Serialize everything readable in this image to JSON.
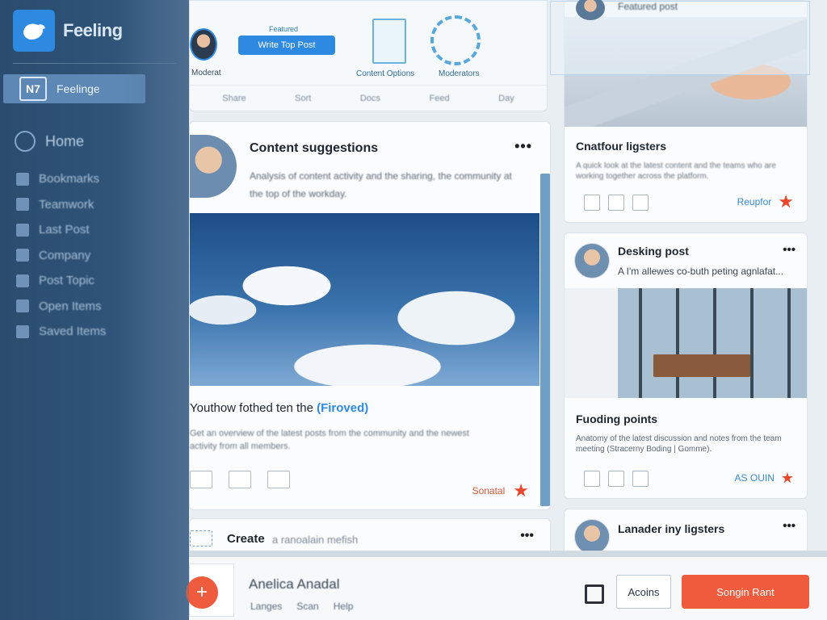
{
  "sidebar": {
    "brand": "Feeling",
    "active_item": {
      "label": "Feelinge",
      "icon_text": "N7"
    },
    "home_label": "Home",
    "items": [
      {
        "label": "Bookmarks"
      },
      {
        "label": "Teamwork"
      },
      {
        "label": "Last Post"
      },
      {
        "label": "Company"
      },
      {
        "label": "Post Topic"
      },
      {
        "label": "Open Items"
      },
      {
        "label": "Saved Items"
      }
    ]
  },
  "top_strip": {
    "user_label": "Moderat",
    "tag": "Featured",
    "button_label": "Write Top Post",
    "doc_label": "Content Options",
    "gear_label": "Moderators",
    "tabs": [
      "Share",
      "Sort",
      "Docs",
      "Feed",
      "Day"
    ]
  },
  "main_card": {
    "title": "Content suggestions",
    "more": "•••",
    "text": "Analysis of content activity and the sharing, the community at the top of the workday.",
    "headline_prefix": "Youthow fothed ten the ",
    "headline_highlight": "(Firoved)",
    "body": "Get an overview of the latest posts from the community and the newest activity from all members.",
    "action_label": "Sonatal"
  },
  "create": {
    "label": "Create",
    "sublabel": "a ranoalain mefish",
    "more": "•••"
  },
  "right_col": {
    "card1": {
      "top_title": "Featured post",
      "title": "Cnatfour ligsters",
      "text": "A quick look at the latest content and the teams who are working together across the platform.",
      "action_label": "Reupfor"
    },
    "card2": {
      "title": "Desking post",
      "subtitle": "A I'm allewes co-buth peting agnlafat...",
      "more": "•••",
      "title2": "Fuoding points",
      "text": "Anatomy of the latest discussion and notes from the team meeting (Stracerny Boding | Gomme).",
      "action_label": "AS OUIN"
    },
    "card3": {
      "title": "Lanader iny ligsters",
      "more": "•••"
    }
  },
  "bottom_bar": {
    "name": "Anelica Anadal",
    "meta": [
      "Langes",
      "Scan",
      "Help"
    ],
    "ghost_label": "Acoins",
    "primary_label": "Songin Rant"
  },
  "colors": {
    "accent": "#2d8ae0",
    "action": "#ee5b3d",
    "sidebar": "#2f5478"
  }
}
